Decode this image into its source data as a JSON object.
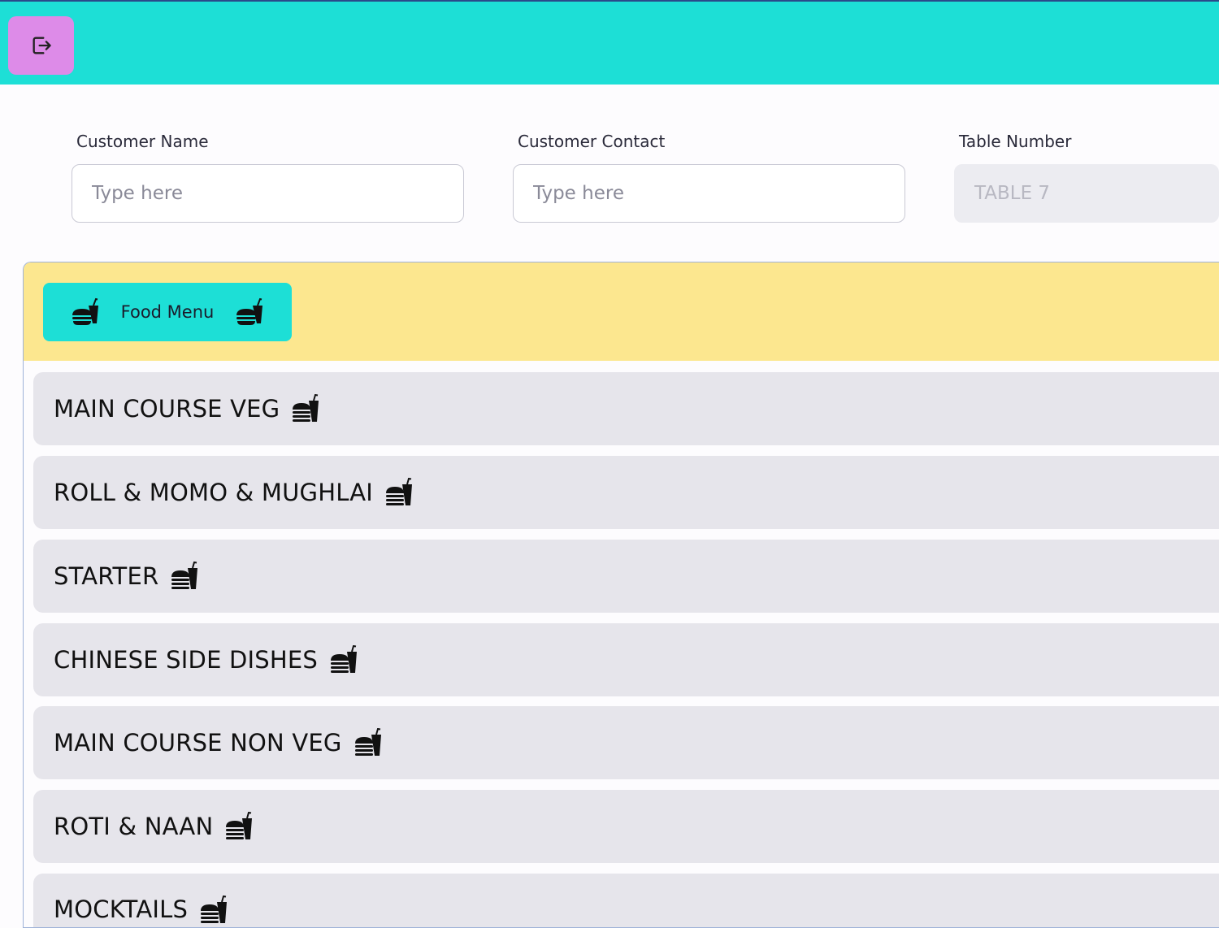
{
  "header": {
    "logout_icon": "logout-icon",
    "colors": {
      "bar": "#1ddfd6",
      "logout_button": "#dd8be8"
    }
  },
  "form": {
    "customer_name": {
      "label": "Customer Name",
      "placeholder": "Type here"
    },
    "customer_contact": {
      "label": "Customer Contact",
      "placeholder": "Type here"
    },
    "table_number": {
      "label": "Table Number",
      "value": "TABLE 7"
    }
  },
  "menu": {
    "title": "Food Menu",
    "icon": "burger-drink-icon",
    "header_color": "#fce78f",
    "categories": [
      {
        "label": "MAIN COURSE VEG",
        "icon": "fast-food-icon"
      },
      {
        "label": "ROLL & MOMO & MUGHLAI",
        "icon": "fast-food-icon"
      },
      {
        "label": "STARTER",
        "icon": "fast-food-icon"
      },
      {
        "label": "CHINESE SIDE DISHES",
        "icon": "fast-food-icon"
      },
      {
        "label": "MAIN COURSE NON VEG",
        "icon": "fast-food-icon"
      },
      {
        "label": "ROTI & NAAN",
        "icon": "fast-food-icon"
      },
      {
        "label": "MOCKTAILS",
        "icon": "fast-food-icon"
      }
    ]
  }
}
